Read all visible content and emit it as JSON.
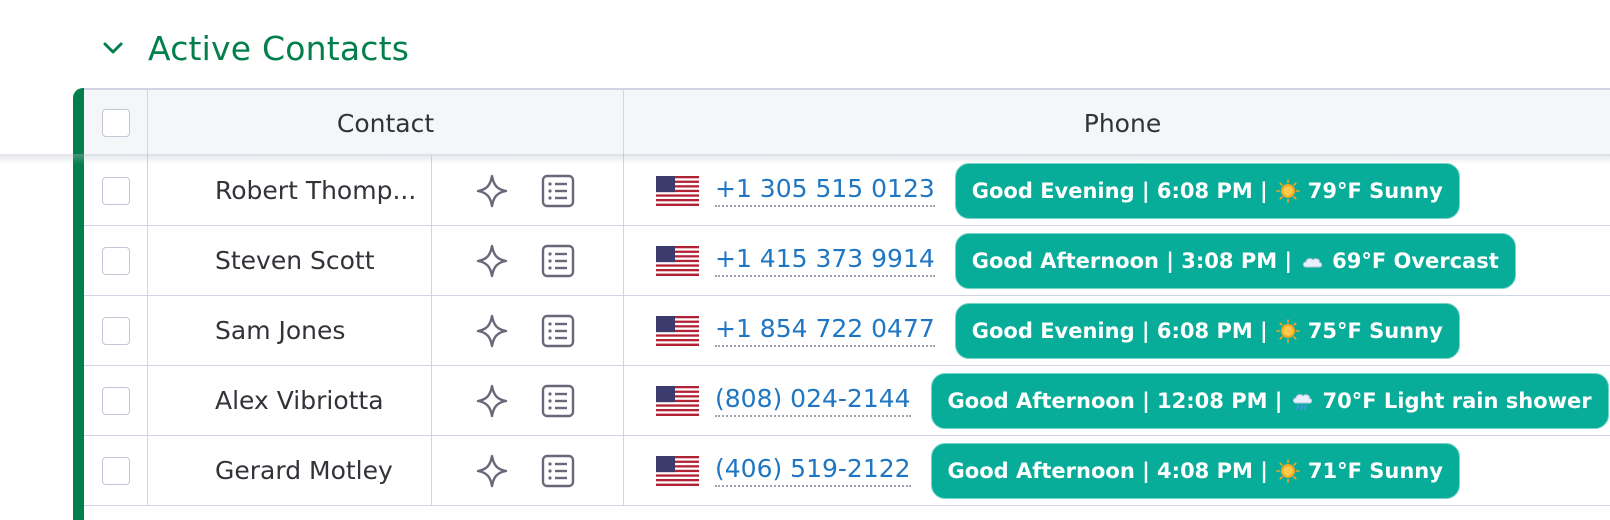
{
  "group": {
    "title": "Active Contacts",
    "accent_color": "#037f4c"
  },
  "table": {
    "headers": {
      "contact": "Contact",
      "phone": "Phone"
    },
    "rows": [
      {
        "name": "Robert Thomp...",
        "phone": "+1 305 515 0123",
        "flag": "us-flag-icon",
        "time_info_prefix": "Good Evening | 6:08 PM |",
        "weather_icon": "sun-icon",
        "weather_text": "79°F Sunny"
      },
      {
        "name": "Steven Scott",
        "phone": "+1 415 373 9914",
        "flag": "us-flag-icon",
        "time_info_prefix": "Good Afternoon | 3:08 PM |",
        "weather_icon": "cloud-icon",
        "weather_text": "69°F Overcast"
      },
      {
        "name": "Sam Jones",
        "phone": "+1 854 722 0477",
        "flag": "us-flag-icon",
        "time_info_prefix": "Good Evening | 6:08 PM |",
        "weather_icon": "sun-icon",
        "weather_text": "75°F Sunny"
      },
      {
        "name": "Alex Vibriotta",
        "phone": "(808) 024-2144",
        "flag": "us-flag-icon",
        "time_info_prefix": "Good Afternoon | 12:08 PM |",
        "weather_icon": "rain-cloud-icon",
        "weather_text": "70°F Light rain shower"
      },
      {
        "name": "Gerard Motley",
        "phone": "(406) 519-2122",
        "flag": "us-flag-icon",
        "time_info_prefix": "Good Afternoon | 4:08 PM |",
        "weather_icon": "sun-icon",
        "weather_text": "71°F Sunny"
      }
    ]
  },
  "colors": {
    "pill_bg": "#08ad9a",
    "phone_link": "#1f76c2",
    "grid_line": "#d0d4e4"
  }
}
